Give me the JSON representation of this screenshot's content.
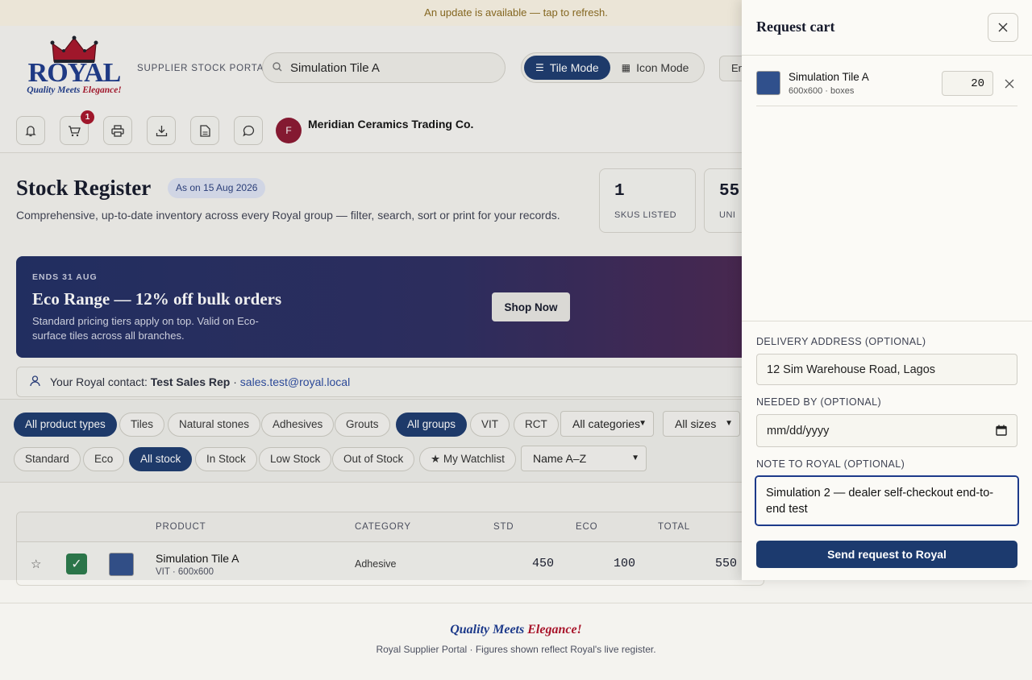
{
  "update_bar": {
    "text": "An update is available — tap to refresh."
  },
  "brand": {
    "logo_word": "ROYAL",
    "tagline_a": "Quality Meets ",
    "tagline_b": "Elegance!",
    "portal_label": "SUPPLIER STOCK PORTAL"
  },
  "search": {
    "value": "Simulation Tile A"
  },
  "modes": [
    {
      "label": "Tile Mode",
      "active": true
    },
    {
      "label": "Icon Mode",
      "active": false
    }
  ],
  "language": {
    "value": "En"
  },
  "toolbar": {
    "cart_badge": "1"
  },
  "user": {
    "initial": "F",
    "company": "Meridian Ceramics Trading Co."
  },
  "header": {
    "title": "Stock Register",
    "as_on": "As on 15 Aug 2026",
    "subtitle": "Comprehensive, up-to-date inventory across every Royal group — filter, search, sort or print for your records."
  },
  "stats": [
    {
      "value": "1",
      "label": "SKUS LISTED"
    },
    {
      "value": "55",
      "label": "UNI"
    }
  ],
  "promo": {
    "ends": "ENDS 31 AUG",
    "headline": "Eco Range — 12% off bulk orders",
    "desc": "Standard pricing tiers apply on top. Valid on Eco-surface tiles across all branches.",
    "cta": "Shop Now"
  },
  "contact": {
    "prefix": "Your Royal contact:",
    "name": "Test Sales Rep",
    "email": "sales.test@royal.local"
  },
  "filters": {
    "product_types": [
      "All product types",
      "Tiles",
      "Natural stones",
      "Adhesives",
      "Grouts"
    ],
    "groups": [
      "All groups",
      "VIT",
      "RCT"
    ],
    "category_select": "All categories",
    "size_select": "All sizes",
    "ranges": [
      "Standard",
      "Eco"
    ],
    "stock": [
      "All stock",
      "In Stock",
      "Low Stock",
      "Out of Stock",
      "★ My Watchlist"
    ],
    "sort_select": "Name A–Z"
  },
  "table": {
    "headers": [
      "PRODUCT",
      "CATEGORY",
      "STD",
      "ECO",
      "TOTAL"
    ],
    "rows": [
      {
        "name": "Simulation Tile A",
        "sub": "VIT · 600x600",
        "category": "Adhesive",
        "std": "450",
        "eco": "100",
        "total": "550"
      }
    ]
  },
  "footer": {
    "slogan_a": "Quality Meets ",
    "slogan_b": "Elegance!",
    "note": "Royal Supplier Portal · Figures shown reflect Royal's live register."
  },
  "cart": {
    "title": "Request cart",
    "items": [
      {
        "name": "Simulation Tile A",
        "meta": "600x600 · boxes",
        "qty": "20"
      }
    ],
    "address_label": "DELIVERY ADDRESS (OPTIONAL)",
    "address_value": "12 Sim Warehouse Road, Lagos",
    "needed_label": "NEEDED BY (OPTIONAL)",
    "needed_placeholder": "mm/dd/yyyy",
    "note_label": "NOTE TO ROYAL (OPTIONAL)",
    "note_value": "Simulation 2 — dealer self-checkout end-to-end test",
    "send_label": "Send request to Royal"
  },
  "colors": {
    "accent": "#1c3a6e",
    "brand_red": "#a8142a",
    "brand_blue": "#1d3a8a",
    "success": "#2a7a4a"
  }
}
